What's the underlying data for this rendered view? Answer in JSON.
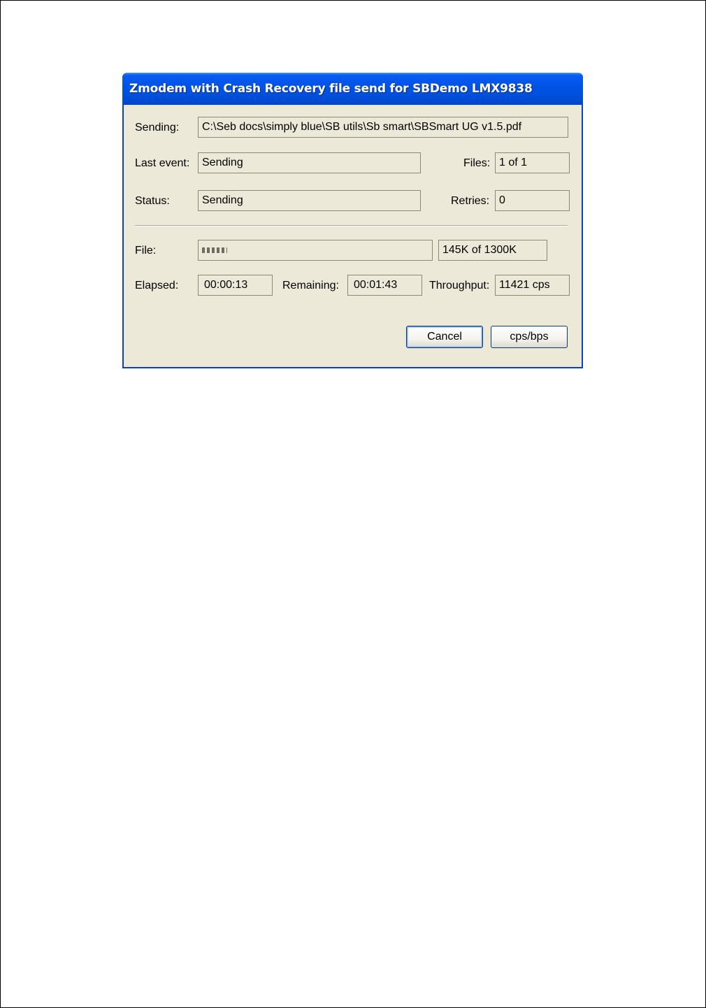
{
  "dialog": {
    "title": "Zmodem with Crash Recovery file send for SBDemo LMX9838"
  },
  "fields": {
    "sending_label": "Sending:",
    "sending_value": "C:\\Seb docs\\simply blue\\SB utils\\Sb smart\\SBSmart UG v1.5.pdf",
    "last_event_label": "Last event:",
    "last_event_value": "Sending",
    "files_label": "Files:",
    "files_value": "1 of 1",
    "status_label": "Status:",
    "status_value": "Sending",
    "retries_label": "Retries:",
    "retries_value": "0",
    "file_label": "File:",
    "file_progress_fraction": 0.11,
    "file_progress_text": "145K of 1300K",
    "elapsed_label": "Elapsed:",
    "elapsed_value": "00:00:13",
    "remaining_label": "Remaining:",
    "remaining_value": "00:01:43",
    "throughput_label": "Throughput:",
    "throughput_value": "11421 cps"
  },
  "buttons": {
    "cancel_label": "Cancel",
    "cps_bps_label": "cps/bps"
  },
  "colors": {
    "titlebar": "#0053e6",
    "dialog_bg": "#ece9d8",
    "page_bg": "#ffffff"
  }
}
